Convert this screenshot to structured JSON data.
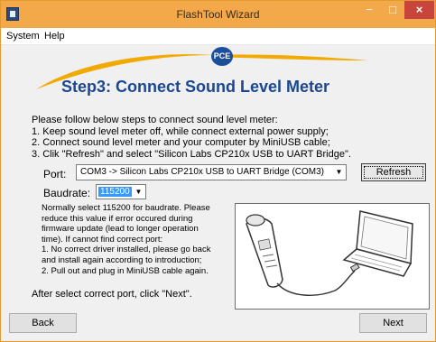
{
  "window": {
    "title": "FlashTool Wizard",
    "controls": {
      "minimize": "−",
      "maximize": "□",
      "close": "×"
    }
  },
  "menu": {
    "items": [
      "System",
      "Help"
    ]
  },
  "logo": {
    "text": "PCE"
  },
  "step": {
    "title": "Step3: Connect Sound Level Meter"
  },
  "instructions": [
    "Please follow below steps to connect sound level meter:",
    "1. Keep sound level meter off, while connect external power supply;",
    "2. Connect sound level meter and your computer by MiniUSB cable;",
    "3. Clik \"Refresh\" and select \"Silicon Labs CP210x USB to UART Bridge\"."
  ],
  "port": {
    "label": "Port:",
    "selected": "COM3 -> Silicon Labs CP210x USB to UART Bridge (COM3)",
    "refresh_label": "Refresh"
  },
  "baudrate": {
    "label": "Baudrate:",
    "selected": "115200"
  },
  "note": [
    "Normally select 115200 for baudrate. Please",
    "reduce this value if error occured during",
    "firmware update (lead to longer operation",
    "time). If cannot find correct port:",
    "1. No correct driver installed, please go back",
    "and install again according to introduction;",
    "2. Pull out and plug in MiniUSB cable again."
  ],
  "after_text": "After select correct port, click \"Next\".",
  "buttons": {
    "back": "Back",
    "next": "Next"
  },
  "colors": {
    "titlebar": "#f3a94a",
    "close": "#c7453a",
    "step_title": "#1a4791",
    "accent_swoosh": "#f2a900",
    "selection": "#3399ff"
  },
  "icons": [
    "app-icon",
    "pce-logo",
    "dropdown-arrow-icon",
    "sound-meter-usb-illustration"
  ]
}
